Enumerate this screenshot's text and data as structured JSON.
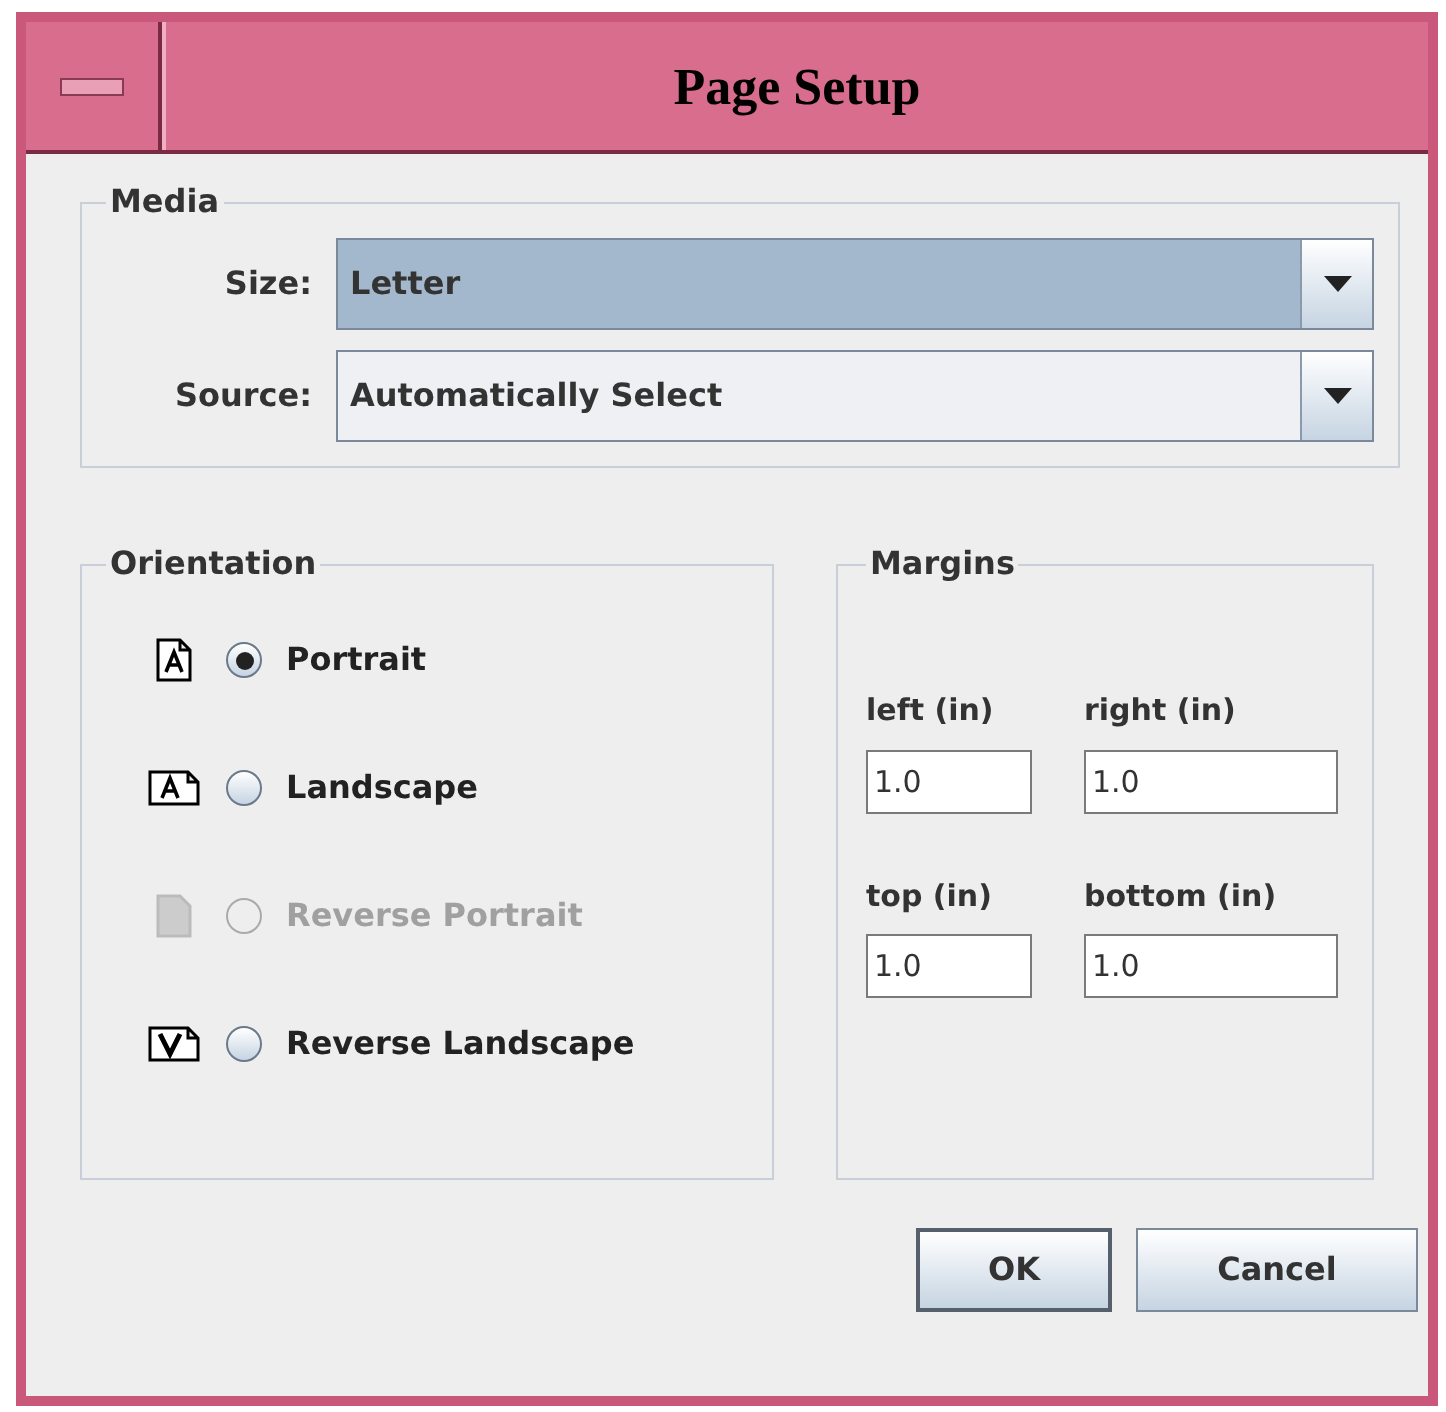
{
  "window": {
    "title": "Page Setup"
  },
  "media": {
    "title": "Media",
    "fields": [
      {
        "label": "Size:",
        "value": "Letter",
        "selected": true
      },
      {
        "label": "Source:",
        "value": "Automatically Select",
        "selected": false
      }
    ]
  },
  "orientation": {
    "title": "Orientation",
    "options": [
      {
        "label": "Portrait",
        "kind": "portrait",
        "selected": true,
        "disabled": false
      },
      {
        "label": "Landscape",
        "kind": "landscape",
        "selected": false,
        "disabled": false
      },
      {
        "label": "Reverse Portrait",
        "kind": "reverse-portrait",
        "selected": false,
        "disabled": true
      },
      {
        "label": "Reverse Landscape",
        "kind": "reverse-landscape",
        "selected": false,
        "disabled": false
      }
    ]
  },
  "margins": {
    "title": "Margins",
    "fields": [
      {
        "label": "left (in)",
        "value": "1.0"
      },
      {
        "label": "right (in)",
        "value": "1.0"
      },
      {
        "label": "top (in)",
        "value": "1.0"
      },
      {
        "label": "bottom (in)",
        "value": "1.0"
      }
    ]
  },
  "buttons": [
    {
      "label": "OK",
      "selected": true
    },
    {
      "label": "Cancel",
      "selected": false
    }
  ]
}
